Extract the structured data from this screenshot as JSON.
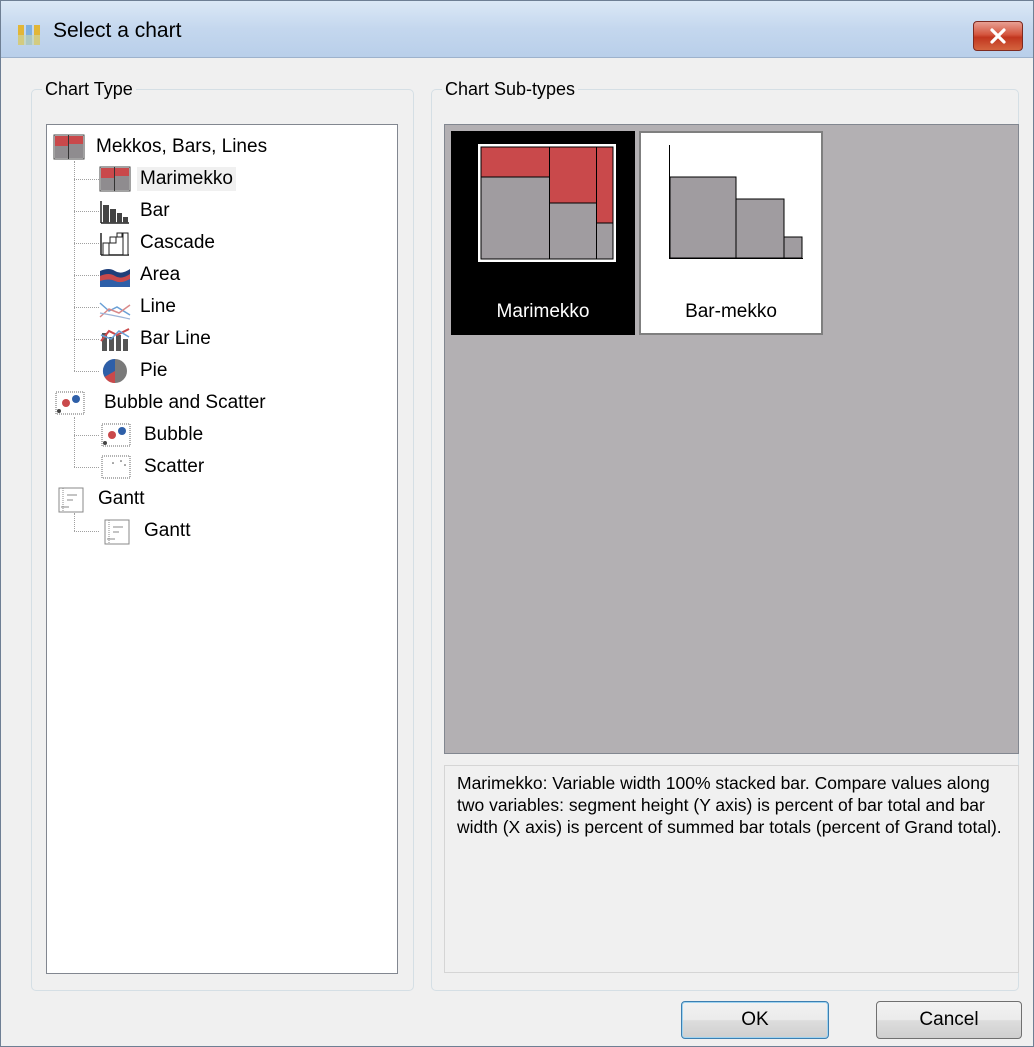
{
  "window": {
    "title": "Select a chart",
    "close_label": "×"
  },
  "chart_type_group": {
    "legend": "Chart Type",
    "tree": [
      {
        "label": "Mekkos, Bars, Lines",
        "icon": "mekko-group-icon",
        "children": [
          {
            "label": "Marimekko",
            "icon": "marimekko-icon",
            "selected": true
          },
          {
            "label": "Bar",
            "icon": "bar-icon"
          },
          {
            "label": "Cascade",
            "icon": "cascade-icon"
          },
          {
            "label": "Area",
            "icon": "area-icon"
          },
          {
            "label": "Line",
            "icon": "line-icon"
          },
          {
            "label": "Bar Line",
            "icon": "bar-line-icon"
          },
          {
            "label": "Pie",
            "icon": "pie-icon"
          }
        ]
      },
      {
        "label": "Bubble and Scatter",
        "icon": "bubble-group-icon",
        "children": [
          {
            "label": "Bubble",
            "icon": "bubble-icon"
          },
          {
            "label": "Scatter",
            "icon": "scatter-icon"
          }
        ]
      },
      {
        "label": "Gantt",
        "icon": "gantt-group-icon",
        "children": [
          {
            "label": "Gantt",
            "icon": "gantt-icon"
          }
        ]
      }
    ]
  },
  "sub_types_group": {
    "legend": "Chart Sub-types",
    "items": [
      {
        "label": "Marimekko",
        "icon": "marimekko-preview-icon",
        "selected": true
      },
      {
        "label": "Bar-mekko",
        "icon": "bar-mekko-preview-icon",
        "selected": false
      }
    ],
    "description": "Marimekko: Variable width 100% stacked bar.  Compare values along two variables:  segment height (Y axis) is percent of bar total and bar width (X axis) is percent of summed bar totals (percent of Grand total)."
  },
  "buttons": {
    "ok": "OK",
    "cancel": "Cancel"
  },
  "colors": {
    "accent_red": "#c9494b",
    "bar_gray": "#a09ca0",
    "panel_gray": "#b3b0b3",
    "selection_black": "#000000"
  }
}
